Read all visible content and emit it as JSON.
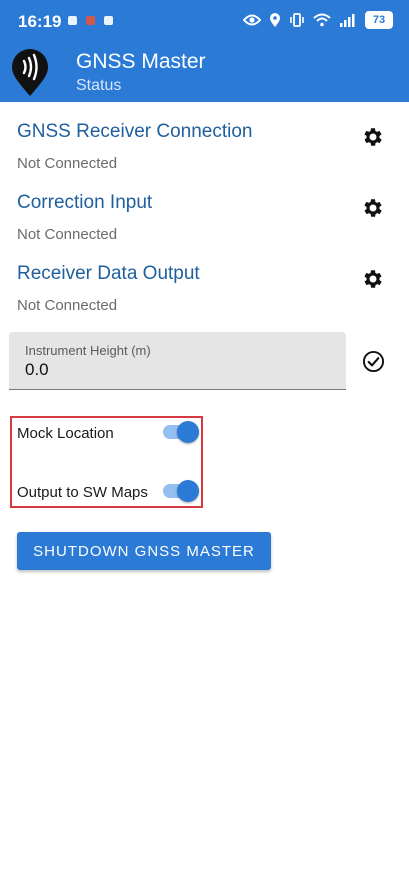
{
  "status_bar": {
    "time": "16:19",
    "battery": "73",
    "left_icons": [
      "notification-icon",
      "app-notification-icon",
      "shield-notification-icon"
    ],
    "right_icons": [
      "eye-icon",
      "location-icon",
      "vibrate-icon",
      "wifi-icon",
      "signal-icon",
      "battery-icon"
    ]
  },
  "app_bar": {
    "title": "GNSS Master",
    "subtitle": "Status",
    "color": "#2a7ad6"
  },
  "sections": [
    {
      "title": "GNSS Receiver Connection",
      "status": "Not Connected",
      "icon": "gear-icon"
    },
    {
      "title": "Correction Input",
      "status": "Not Connected",
      "icon": "gear-icon"
    },
    {
      "title": "Receiver Data Output",
      "status": "Not Connected",
      "icon": "gear-icon"
    }
  ],
  "instrument_height": {
    "label": "Instrument Height (m)",
    "value": "0.0",
    "confirm_icon": "check-circle-icon"
  },
  "toggles": [
    {
      "label": "Mock Location",
      "on": true
    },
    {
      "label": "Output to SW Maps",
      "on": true
    }
  ],
  "shutdown_button": {
    "label": "SHUTDOWN GNSS MASTER"
  },
  "colors": {
    "accent": "#2a7ad6",
    "section_title": "#1f5f9e",
    "highlight_border": "#d6393f"
  }
}
